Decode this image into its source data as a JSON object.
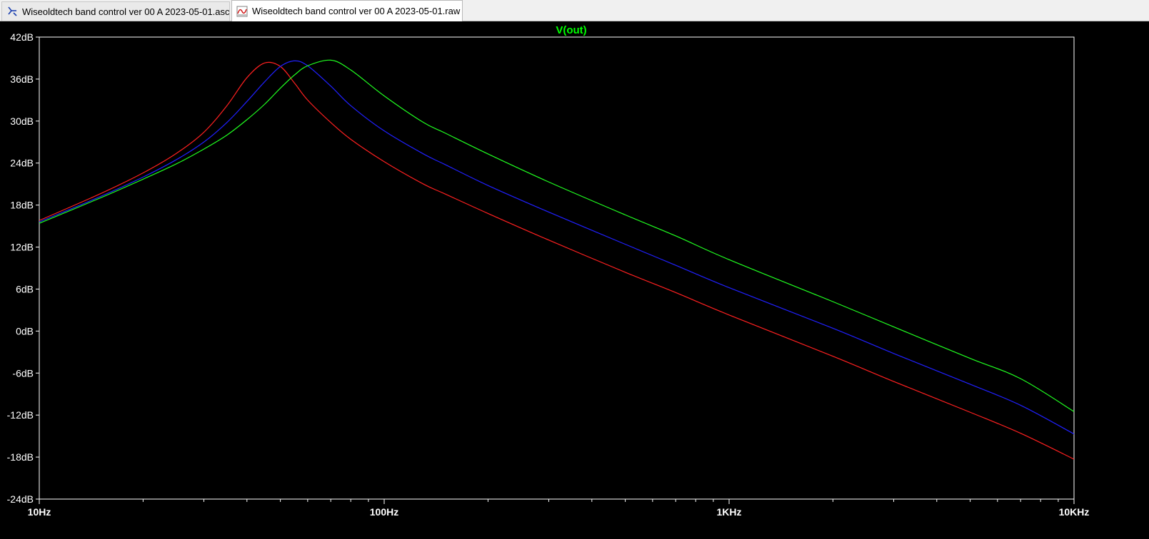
{
  "tabs": [
    {
      "label": "Wiseoldtech band control ver 00 A 2023-05-01.asc",
      "icon": "schematic-icon",
      "active": false
    },
    {
      "label": "Wiseoldtech band control ver 00 A 2023-05-01.raw",
      "icon": "waveform-icon",
      "active": true
    }
  ],
  "plot": {
    "trace_label": "V(out)",
    "trace_label_color": "#00ff00",
    "axis_color": "#ffffff",
    "background": "#000000"
  },
  "chart_data": {
    "type": "line",
    "title": "V(out)",
    "x_scale": "log",
    "xlim": [
      10,
      10000
    ],
    "ylim": [
      -24,
      42
    ],
    "x_ticks": [
      {
        "value": 10,
        "label": "10Hz"
      },
      {
        "value": 100,
        "label": "100Hz"
      },
      {
        "value": 1000,
        "label": "1KHz"
      },
      {
        "value": 10000,
        "label": "10KHz"
      }
    ],
    "y_ticks": [
      {
        "value": 42,
        "label": "42dB"
      },
      {
        "value": 36,
        "label": "36dB"
      },
      {
        "value": 30,
        "label": "30dB"
      },
      {
        "value": 24,
        "label": "24dB"
      },
      {
        "value": 18,
        "label": "18dB"
      },
      {
        "value": 12,
        "label": "12dB"
      },
      {
        "value": 6,
        "label": "6dB"
      },
      {
        "value": 0,
        "label": "0dB"
      },
      {
        "value": -6,
        "label": "-6dB"
      },
      {
        "value": -12,
        "label": "-12dB"
      },
      {
        "value": -18,
        "label": "-18dB"
      },
      {
        "value": -24,
        "label": "-24dB"
      }
    ],
    "grid": false,
    "series": [
      {
        "color": "#ff2020",
        "x": [
          10,
          15,
          20,
          25,
          30,
          35,
          40,
          45,
          50,
          55,
          60,
          70,
          80,
          100,
          130,
          150,
          200,
          300,
          500,
          700,
          1000,
          2000,
          3000,
          5000,
          7000,
          10000
        ],
        "y": [
          15.8,
          19.6,
          22.6,
          25.4,
          28.4,
          32.2,
          36.2,
          38.3,
          37.8,
          35.4,
          33.0,
          29.8,
          27.4,
          24.2,
          21.0,
          19.6,
          16.8,
          13.0,
          8.4,
          5.5,
          2.3,
          -3.6,
          -7.2,
          -11.6,
          -14.6,
          -18.3
        ]
      },
      {
        "color": "#2020ff",
        "x": [
          10,
          15,
          20,
          25,
          30,
          35,
          40,
          45,
          50,
          55,
          60,
          70,
          80,
          100,
          130,
          150,
          200,
          300,
          500,
          700,
          1000,
          2000,
          3000,
          5000,
          7000,
          10000
        ],
        "y": [
          15.6,
          19.2,
          22.0,
          24.5,
          27.0,
          29.8,
          32.8,
          35.6,
          37.8,
          38.6,
          37.9,
          35.0,
          32.2,
          28.6,
          25.3,
          23.8,
          20.8,
          17.0,
          12.4,
          9.4,
          6.2,
          0.4,
          -3.2,
          -7.6,
          -10.6,
          -14.7
        ]
      },
      {
        "color": "#20ff20",
        "x": [
          10,
          15,
          20,
          25,
          30,
          35,
          40,
          45,
          50,
          55,
          60,
          70,
          80,
          100,
          130,
          150,
          200,
          300,
          500,
          700,
          1000,
          2000,
          3000,
          5000,
          7000,
          10000
        ],
        "y": [
          15.4,
          19.0,
          21.7,
          23.9,
          26.0,
          28.0,
          30.2,
          32.4,
          34.7,
          36.6,
          37.9,
          38.7,
          37.3,
          33.6,
          29.8,
          28.3,
          25.3,
          21.3,
          16.6,
          13.6,
          10.2,
          4.2,
          0.6,
          -3.9,
          -6.8,
          -11.5
        ]
      }
    ]
  }
}
